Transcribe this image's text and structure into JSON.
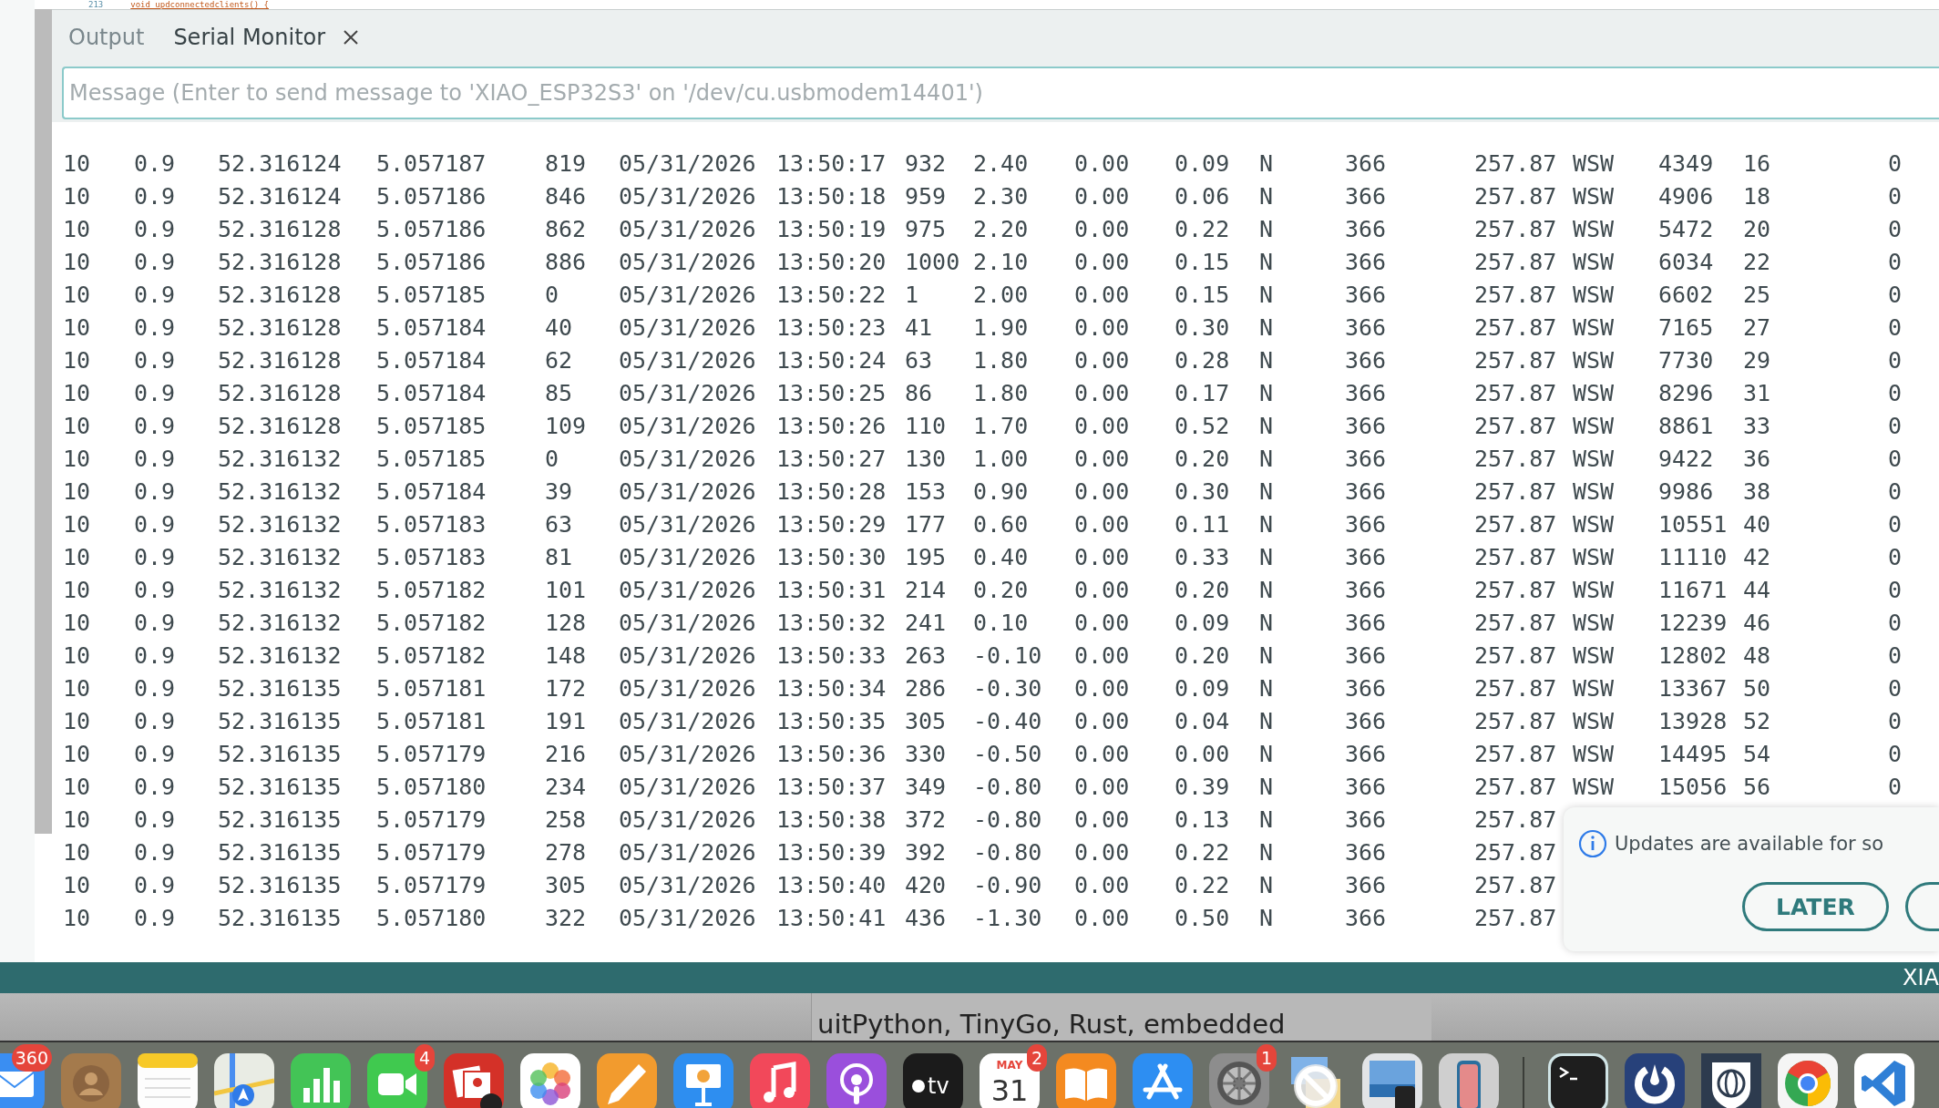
{
  "editor": {
    "line_number": "213",
    "code": "void updconnectedclients() {"
  },
  "panel": {
    "tabs": [
      {
        "label": "Output",
        "selected": false,
        "closable": false
      },
      {
        "label": "Serial Monitor",
        "selected": true,
        "closable": true
      }
    ]
  },
  "message_field": {
    "placeholder": "Message (Enter to send message to 'XIAO_ESP32S3' on '/dev/cu.usbmodem14401')"
  },
  "serial_lines": [
    {
      "cells": [
        "10",
        "0.9",
        "52.316124",
        "5.057187",
        "819",
        "05/31/2026",
        "13:50:17",
        "932",
        "2.40",
        "0.00",
        "0.09",
        "N",
        "366",
        "257.87",
        "WSW",
        "4349",
        "16",
        "0"
      ]
    },
    {
      "cells": [
        "10",
        "0.9",
        "52.316124",
        "5.057186",
        "846",
        "05/31/2026",
        "13:50:18",
        "959",
        "2.30",
        "0.00",
        "0.06",
        "N",
        "366",
        "257.87",
        "WSW",
        "4906",
        "18",
        "0"
      ]
    },
    {
      "cells": [
        "10",
        "0.9",
        "52.316128",
        "5.057186",
        "862",
        "05/31/2026",
        "13:50:19",
        "975",
        "2.20",
        "0.00",
        "0.22",
        "N",
        "366",
        "257.87",
        "WSW",
        "5472",
        "20",
        "0"
      ]
    },
    {
      "cells": [
        "10",
        "0.9",
        "52.316128",
        "5.057186",
        "886",
        "05/31/2026",
        "13:50:20",
        "1000",
        "2.10",
        "0.00",
        "0.15",
        "N",
        "366",
        "257.87",
        "WSW",
        "6034",
        "22",
        "0"
      ]
    },
    {
      "cells": [
        "10",
        "0.9",
        "52.316128",
        "5.057185",
        "0",
        "05/31/2026",
        "13:50:22",
        "1",
        "2.00",
        "0.00",
        "0.15",
        "N",
        "366",
        "257.87",
        "WSW",
        "6602",
        "25",
        "0"
      ]
    },
    {
      "cells": [
        "10",
        "0.9",
        "52.316128",
        "5.057184",
        "40",
        "05/31/2026",
        "13:50:23",
        "41",
        "1.90",
        "0.00",
        "0.30",
        "N",
        "366",
        "257.87",
        "WSW",
        "7165",
        "27",
        "0"
      ]
    },
    {
      "cells": [
        "10",
        "0.9",
        "52.316128",
        "5.057184",
        "62",
        "05/31/2026",
        "13:50:24",
        "63",
        "1.80",
        "0.00",
        "0.28",
        "N",
        "366",
        "257.87",
        "WSW",
        "7730",
        "29",
        "0"
      ]
    },
    {
      "cells": [
        "10",
        "0.9",
        "52.316128",
        "5.057184",
        "85",
        "05/31/2026",
        "13:50:25",
        "86",
        "1.80",
        "0.00",
        "0.17",
        "N",
        "366",
        "257.87",
        "WSW",
        "8296",
        "31",
        "0"
      ]
    },
    {
      "cells": [
        "10",
        "0.9",
        "52.316128",
        "5.057185",
        "109",
        "05/31/2026",
        "13:50:26",
        "110",
        "1.70",
        "0.00",
        "0.52",
        "N",
        "366",
        "257.87",
        "WSW",
        "8861",
        "33",
        "0"
      ]
    },
    {
      "cells": [
        "10",
        "0.9",
        "52.316132",
        "5.057185",
        "0",
        "05/31/2026",
        "13:50:27",
        "130",
        "1.00",
        "0.00",
        "0.20",
        "N",
        "366",
        "257.87",
        "WSW",
        "9422",
        "36",
        "0"
      ]
    },
    {
      "cells": [
        "10",
        "0.9",
        "52.316132",
        "5.057184",
        "39",
        "05/31/2026",
        "13:50:28",
        "153",
        "0.90",
        "0.00",
        "0.30",
        "N",
        "366",
        "257.87",
        "WSW",
        "9986",
        "38",
        "0"
      ]
    },
    {
      "cells": [
        "10",
        "0.9",
        "52.316132",
        "5.057183",
        "63",
        "05/31/2026",
        "13:50:29",
        "177",
        "0.60",
        "0.00",
        "0.11",
        "N",
        "366",
        "257.87",
        "WSW",
        "10551",
        "40",
        "0"
      ]
    },
    {
      "cells": [
        "10",
        "0.9",
        "52.316132",
        "5.057183",
        "81",
        "05/31/2026",
        "13:50:30",
        "195",
        "0.40",
        "0.00",
        "0.33",
        "N",
        "366",
        "257.87",
        "WSW",
        "11110",
        "42",
        "0"
      ]
    },
    {
      "cells": [
        "10",
        "0.9",
        "52.316132",
        "5.057182",
        "101",
        "05/31/2026",
        "13:50:31",
        "214",
        "0.20",
        "0.00",
        "0.20",
        "N",
        "366",
        "257.87",
        "WSW",
        "11671",
        "44",
        "0"
      ]
    },
    {
      "cells": [
        "10",
        "0.9",
        "52.316132",
        "5.057182",
        "128",
        "05/31/2026",
        "13:50:32",
        "241",
        "0.10",
        "0.00",
        "0.09",
        "N",
        "366",
        "257.87",
        "WSW",
        "12239",
        "46",
        "0"
      ]
    },
    {
      "cells": [
        "10",
        "0.9",
        "52.316132",
        "5.057182",
        "148",
        "05/31/2026",
        "13:50:33",
        "263",
        "-0.10",
        "0.00",
        "0.20",
        "N",
        "366",
        "257.87",
        "WSW",
        "12802",
        "48",
        "0"
      ]
    },
    {
      "cells": [
        "10",
        "0.9",
        "52.316135",
        "5.057181",
        "172",
        "05/31/2026",
        "13:50:34",
        "286",
        "-0.30",
        "0.00",
        "0.09",
        "N",
        "366",
        "257.87",
        "WSW",
        "13367",
        "50",
        "0"
      ]
    },
    {
      "cells": [
        "10",
        "0.9",
        "52.316135",
        "5.057181",
        "191",
        "05/31/2026",
        "13:50:35",
        "305",
        "-0.40",
        "0.00",
        "0.04",
        "N",
        "366",
        "257.87",
        "WSW",
        "13928",
        "52",
        "0"
      ]
    },
    {
      "cells": [
        "10",
        "0.9",
        "52.316135",
        "5.057179",
        "216",
        "05/31/2026",
        "13:50:36",
        "330",
        "-0.50",
        "0.00",
        "0.00",
        "N",
        "366",
        "257.87",
        "WSW",
        "14495",
        "54",
        "0"
      ]
    },
    {
      "cells": [
        "10",
        "0.9",
        "52.316135",
        "5.057180",
        "234",
        "05/31/2026",
        "13:50:37",
        "349",
        "-0.80",
        "0.00",
        "0.39",
        "N",
        "366",
        "257.87",
        "WSW",
        "15056",
        "56",
        "0"
      ]
    },
    {
      "cells": [
        "10",
        "0.9",
        "52.316135",
        "5.057179",
        "258",
        "05/31/2026",
        "13:50:38",
        "372",
        "-0.80",
        "0.00",
        "0.13",
        "N",
        "366",
        "257.87"
      ]
    },
    {
      "cells": [
        "10",
        "0.9",
        "52.316135",
        "5.057179",
        "278",
        "05/31/2026",
        "13:50:39",
        "392",
        "-0.80",
        "0.00",
        "0.22",
        "N",
        "366",
        "257.87"
      ]
    },
    {
      "cells": [
        "10",
        "0.9",
        "52.316135",
        "5.057179",
        "305",
        "05/31/2026",
        "13:50:40",
        "420",
        "-0.90",
        "0.00",
        "0.22",
        "N",
        "366",
        "257.87"
      ]
    },
    {
      "cells": [
        "10",
        "0.9",
        "52.316135",
        "5.057180",
        "322",
        "05/31/2026",
        "13:50:41",
        "436",
        "-1.30",
        "0.00",
        "0.50",
        "N",
        "366",
        "257.87"
      ]
    }
  ],
  "notification": {
    "text": "Updates are available for so",
    "buttons": [
      {
        "kind": "full",
        "label": "LATER"
      },
      {
        "kind": "cut"
      }
    ]
  },
  "status_bar": {
    "text": "XIA"
  },
  "background_window": {
    "text": "uitPython, TinyGo, Rust, embedded"
  },
  "dock": {
    "items": [
      {
        "kind": "mail",
        "badge": "360"
      },
      {
        "kind": "contacts"
      },
      {
        "kind": "notes"
      },
      {
        "kind": "maps"
      },
      {
        "kind": "numbers"
      },
      {
        "kind": "facetime",
        "badge": "4"
      },
      {
        "kind": "photobooth"
      },
      {
        "kind": "photos"
      },
      {
        "kind": "pages"
      },
      {
        "kind": "keynote"
      },
      {
        "kind": "music"
      },
      {
        "kind": "podcasts"
      },
      {
        "kind": "tv",
        "label": "tv"
      },
      {
        "kind": "calendar",
        "month": "MAY",
        "day": "31",
        "badge": "2"
      },
      {
        "kind": "books"
      },
      {
        "kind": "appstore"
      },
      {
        "kind": "settings",
        "badge": "1"
      },
      {
        "kind": "blocked"
      },
      {
        "kind": "preview"
      },
      {
        "kind": "iphone"
      },
      {
        "kind": "divider"
      },
      {
        "kind": "terminal"
      },
      {
        "kind": "mattermost"
      },
      {
        "kind": "shield"
      },
      {
        "kind": "chrome"
      },
      {
        "kind": "vscode"
      }
    ]
  }
}
